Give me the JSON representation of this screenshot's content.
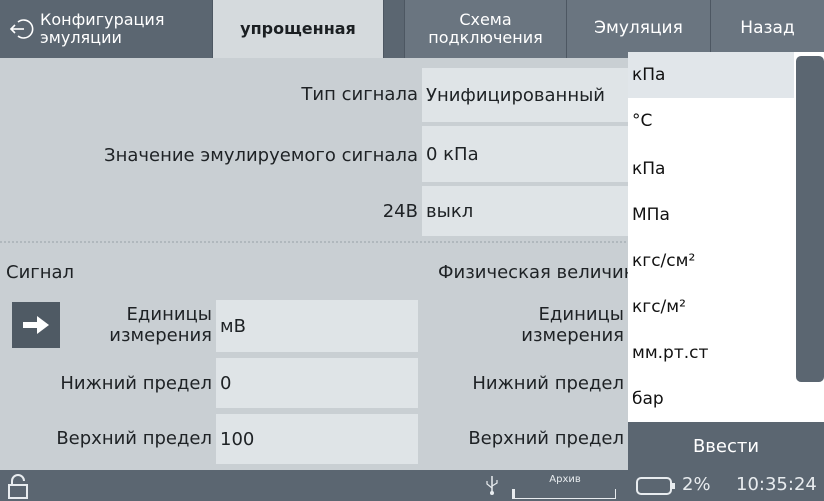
{
  "topbar": {
    "title": "Конфигурация\nэмуляции",
    "tab_simple": "упрощенная",
    "tab_scheme": "Схема\nподключения",
    "tab_emulation": "Эмуляция",
    "back_label": "Назад"
  },
  "emulation": {
    "signal_type_label": "Тип сигнала",
    "signal_type_value": "Унифицированный",
    "value_label": "Значение эмулируемого сигнала",
    "value_value": "0 кПа",
    "v24_label": "24В",
    "v24_value": "выкл"
  },
  "signal": {
    "section_title": "Сигнал",
    "units_label": "Единицы\nизмерения",
    "units_value": "мВ",
    "lower_label": "Нижний предел",
    "lower_value": "0",
    "upper_label": "Верхний предел",
    "upper_value": "100"
  },
  "physical": {
    "section_title": "Физическая величина",
    "units_label": "Единицы\nизмерения",
    "lower_label": "Нижний предел",
    "upper_label": "Верхний предел"
  },
  "dropdown": {
    "items": [
      "кПа",
      "°С",
      "кПа",
      "МПа",
      "кгс/см²",
      "кгс/м²",
      "мм.рт.ст",
      "бар"
    ],
    "selected_index": 0,
    "enter_label": "Ввести"
  },
  "status": {
    "archive_label": "Архив",
    "archive_fill_fraction": 0.02,
    "battery_percent": "2%",
    "time": "10:35:24"
  },
  "icons": [
    "back-arrow-icon",
    "right-arrow-icon",
    "lock-icon",
    "usb-icon",
    "battery-icon"
  ]
}
